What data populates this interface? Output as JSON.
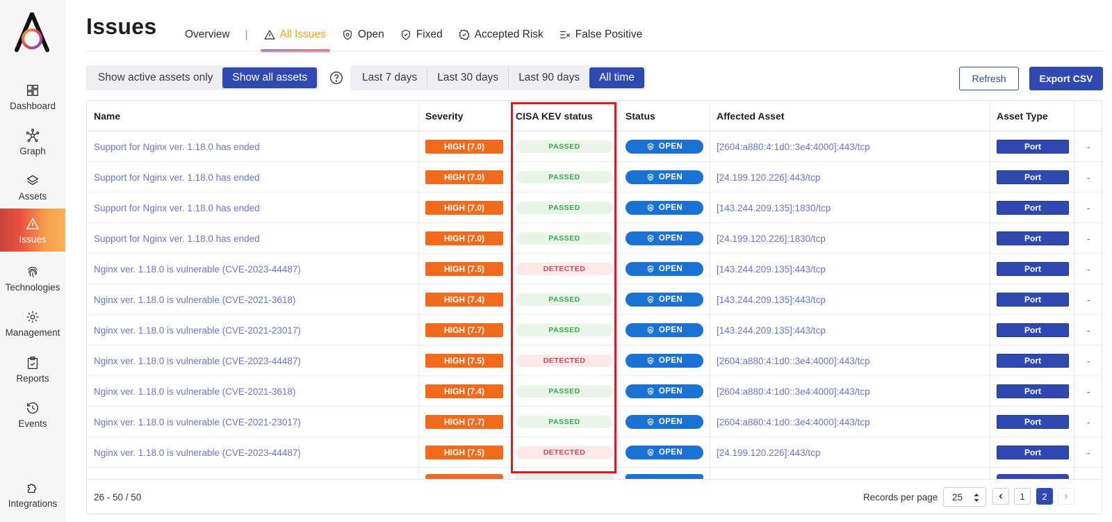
{
  "nav": [
    {
      "id": "dashboard",
      "label": "Dashboard",
      "icon": "dashboard-icon"
    },
    {
      "id": "graph",
      "label": "Graph",
      "icon": "graph-icon"
    },
    {
      "id": "assets",
      "label": "Assets",
      "icon": "layers-icon"
    },
    {
      "id": "issues",
      "label": "Issues",
      "icon": "warning-icon",
      "active": true
    },
    {
      "id": "technologies",
      "label": "Technologies",
      "icon": "fingerprint-icon"
    },
    {
      "id": "management",
      "label": "Management",
      "icon": "gear-icon"
    },
    {
      "id": "reports",
      "label": "Reports",
      "icon": "clipboard-icon"
    },
    {
      "id": "events",
      "label": "Events",
      "icon": "history-icon"
    },
    {
      "id": "integrations",
      "label": "Integrations",
      "icon": "puzzle-icon"
    }
  ],
  "header": {
    "title": "Issues",
    "tabs": [
      {
        "label": "Overview"
      },
      {
        "label": "All Issues",
        "active": true
      },
      {
        "label": "Open"
      },
      {
        "label": "Fixed"
      },
      {
        "label": "Accepted Risk"
      },
      {
        "label": "False Positive"
      }
    ],
    "tab_separator": "|"
  },
  "filters": {
    "assets": {
      "options": [
        "Show active assets only",
        "Show all assets"
      ],
      "selected": "Show all assets"
    },
    "time": {
      "options": [
        "Last 7 days",
        "Last 30 days",
        "Last 90 days",
        "All time"
      ],
      "selected": "All time"
    },
    "refresh_label": "Refresh",
    "export_label": "Export CSV"
  },
  "table": {
    "columns": [
      "Name",
      "Severity",
      "CISA KEV status",
      "Status",
      "Affected Asset",
      "Asset Type"
    ],
    "rows": [
      {
        "name": "Support for Nginx ver. 1.18.0 has ended",
        "severity": "HIGH (7.0)",
        "kev": "PASSED",
        "status": "OPEN",
        "asset": "[2604:a880:4:1d0::3e4:4000]:443/tcp",
        "type": "Port"
      },
      {
        "name": "Support for Nginx ver. 1.18.0 has ended",
        "severity": "HIGH (7.0)",
        "kev": "PASSED",
        "status": "OPEN",
        "asset": "[24.199.120.226]:443/tcp",
        "type": "Port"
      },
      {
        "name": "Support for Nginx ver. 1.18.0 has ended",
        "severity": "HIGH (7.0)",
        "kev": "PASSED",
        "status": "OPEN",
        "asset": "[143.244.209.135]:1830/tcp",
        "type": "Port"
      },
      {
        "name": "Support for Nginx ver. 1.18.0 has ended",
        "severity": "HIGH (7.0)",
        "kev": "PASSED",
        "status": "OPEN",
        "asset": "[24.199.120.226]:1830/tcp",
        "type": "Port"
      },
      {
        "name": "Nginx ver. 1.18.0 is vulnerable (CVE-2023-44487)",
        "severity": "HIGH (7.5)",
        "kev": "DETECTED",
        "status": "OPEN",
        "asset": "[143.244.209.135]:443/tcp",
        "type": "Port"
      },
      {
        "name": "Nginx ver. 1.18.0 is vulnerable (CVE-2021-3618)",
        "severity": "HIGH (7.4)",
        "kev": "PASSED",
        "status": "OPEN",
        "asset": "[143.244.209.135]:443/tcp",
        "type": "Port"
      },
      {
        "name": "Nginx ver. 1.18.0 is vulnerable (CVE-2021-23017)",
        "severity": "HIGH (7.7)",
        "kev": "PASSED",
        "status": "OPEN",
        "asset": "[143.244.209.135]:443/tcp",
        "type": "Port"
      },
      {
        "name": "Nginx ver. 1.18.0 is vulnerable (CVE-2023-44487)",
        "severity": "HIGH (7.5)",
        "kev": "DETECTED",
        "status": "OPEN",
        "asset": "[2604:a880:4:1d0::3e4:4000]:443/tcp",
        "type": "Port"
      },
      {
        "name": "Nginx ver. 1.18.0 is vulnerable (CVE-2021-3618)",
        "severity": "HIGH (7.4)",
        "kev": "PASSED",
        "status": "OPEN",
        "asset": "[2604:a880:4:1d0::3e4:4000]:443/tcp",
        "type": "Port"
      },
      {
        "name": "Nginx ver. 1.18.0 is vulnerable (CVE-2021-23017)",
        "severity": "HIGH (7.7)",
        "kev": "PASSED",
        "status": "OPEN",
        "asset": "[2604:a880:4:1d0::3e4:4000]:443/tcp",
        "type": "Port"
      },
      {
        "name": "Nginx ver. 1.18.0 is vulnerable (CVE-2023-44487)",
        "severity": "HIGH (7.5)",
        "kev": "DETECTED",
        "status": "OPEN",
        "asset": "[24.199.120.226]:443/tcp",
        "type": "Port"
      }
    ],
    "overflow_cell": "-"
  },
  "footer": {
    "range": "26 - 50 / 50",
    "records_per_page_label": "Records per page",
    "records_per_page": "25",
    "pages": [
      "1",
      "2"
    ],
    "current_page": "2"
  },
  "colors": {
    "accent": "#2f49b0",
    "severity_high": "#f26b1d",
    "status_open": "#1a73d4",
    "kev_passed": "#3aa84a",
    "kev_detected": "#e0404c",
    "highlight": "#e8151b",
    "active_tab": "#f7a21b"
  }
}
